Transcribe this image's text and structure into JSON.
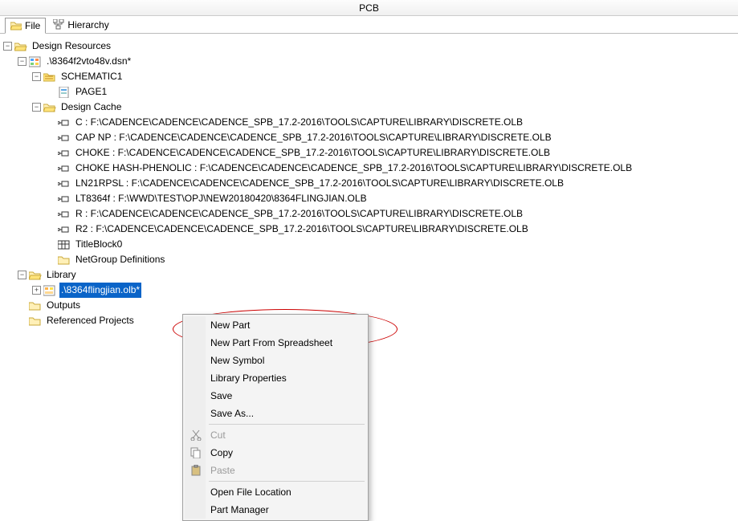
{
  "window": {
    "title": "PCB"
  },
  "tabs": {
    "file": "File",
    "hierarchy": "Hierarchy"
  },
  "tree": {
    "root": "Design Resources",
    "dsn": ".\\8364f2vto48v.dsn*",
    "schematic": "SCHEMATIC1",
    "page": "PAGE1",
    "cache": "Design Cache",
    "cache_items": {
      "c": "C : F:\\CADENCE\\CADENCE\\CADENCE_SPB_17.2-2016\\TOOLS\\CAPTURE\\LIBRARY\\DISCRETE.OLB",
      "cap": "CAP NP : F:\\CADENCE\\CADENCE\\CADENCE_SPB_17.2-2016\\TOOLS\\CAPTURE\\LIBRARY\\DISCRETE.OLB",
      "choke": "CHOKE : F:\\CADENCE\\CADENCE\\CADENCE_SPB_17.2-2016\\TOOLS\\CAPTURE\\LIBRARY\\DISCRETE.OLB",
      "chokehp": "CHOKE HASH-PHENOLIC : F:\\CADENCE\\CADENCE\\CADENCE_SPB_17.2-2016\\TOOLS\\CAPTURE\\LIBRARY\\DISCRETE.OLB",
      "ln21": "LN21RPSL : F:\\CADENCE\\CADENCE\\CADENCE_SPB_17.2-2016\\TOOLS\\CAPTURE\\LIBRARY\\DISCRETE.OLB",
      "lt8364": "LT8364f : F:\\WWD\\TEST\\OPJ\\NEW20180420\\8364FLINGJIAN.OLB",
      "r": "R : F:\\CADENCE\\CADENCE\\CADENCE_SPB_17.2-2016\\TOOLS\\CAPTURE\\LIBRARY\\DISCRETE.OLB",
      "r2": "R2 : F:\\CADENCE\\CADENCE\\CADENCE_SPB_17.2-2016\\TOOLS\\CAPTURE\\LIBRARY\\DISCRETE.OLB",
      "title": "TitleBlock0",
      "netgroup": "NetGroup Definitions"
    },
    "library": "Library",
    "olb": ".\\8364flingjian.olb*",
    "outputs": "Outputs",
    "referenced": "Referenced Projects"
  },
  "context_menu": {
    "new_part": "New Part",
    "new_part_spread": "New Part From Spreadsheet",
    "new_symbol": "New Symbol",
    "lib_props": "Library Properties",
    "save": "Save",
    "save_as": "Save As...",
    "cut": "Cut",
    "copy": "Copy",
    "paste": "Paste",
    "open_loc": "Open File Location",
    "part_mgr": "Part Manager"
  }
}
